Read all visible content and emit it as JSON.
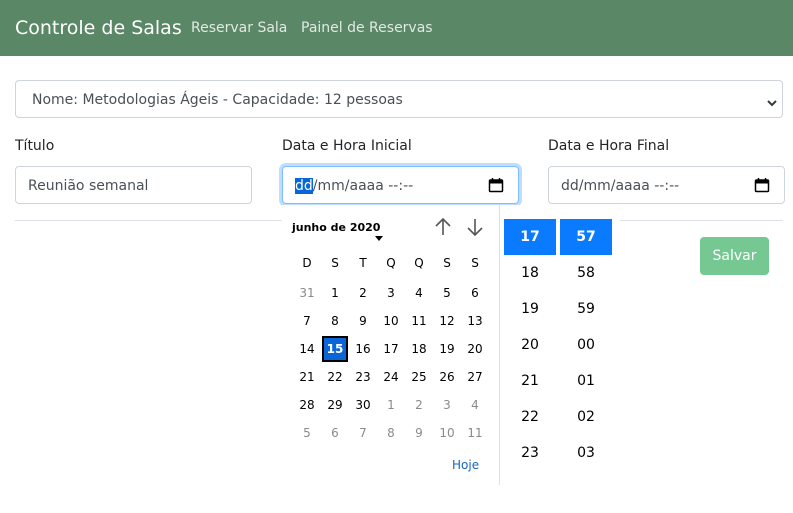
{
  "navbar": {
    "brand": "Controle de Salas",
    "links": [
      "Reservar Sala",
      "Painel de Reservas"
    ],
    "color": "#5a8766"
  },
  "form": {
    "room_select": {
      "value": "Nome: Metodologias Ágeis - Capacidade: 12 pessoas"
    },
    "title": {
      "label": "Título",
      "value": "Reunião semanal"
    },
    "start": {
      "label": "Data e Hora Inicial",
      "placeholder_day": "dd",
      "placeholder_rest": "/mm/aaaa --:--"
    },
    "end": {
      "label": "Data e Hora Final",
      "placeholder": "dd/mm/aaaa --:--"
    },
    "save_label": "Salvar"
  },
  "picker": {
    "month_label": "junho de 2020",
    "weekdays": [
      "D",
      "S",
      "T",
      "Q",
      "Q",
      "S",
      "S"
    ],
    "weeks": [
      [
        "31",
        "1",
        "2",
        "3",
        "4",
        "5",
        "6"
      ],
      [
        "7",
        "8",
        "9",
        "10",
        "11",
        "12",
        "13"
      ],
      [
        "14",
        "15",
        "16",
        "17",
        "18",
        "19",
        "20"
      ],
      [
        "21",
        "22",
        "23",
        "24",
        "25",
        "26",
        "27"
      ],
      [
        "28",
        "29",
        "30",
        "1",
        "2",
        "3",
        "4"
      ],
      [
        "5",
        "6",
        "7",
        "8",
        "9",
        "10",
        "11"
      ]
    ],
    "selected_day": "15",
    "today_label": "Hoje",
    "hours": [
      "17",
      "18",
      "19",
      "20",
      "21",
      "22",
      "23"
    ],
    "minutes": [
      "57",
      "58",
      "59",
      "00",
      "01",
      "02",
      "03"
    ],
    "selected_hour": "17",
    "selected_minute": "57",
    "accent": "#0a7bff"
  },
  "icons": [
    "chevron-down-icon",
    "calendar-icon",
    "arrow-up-icon",
    "arrow-down-icon",
    "caret-down-icon"
  ]
}
